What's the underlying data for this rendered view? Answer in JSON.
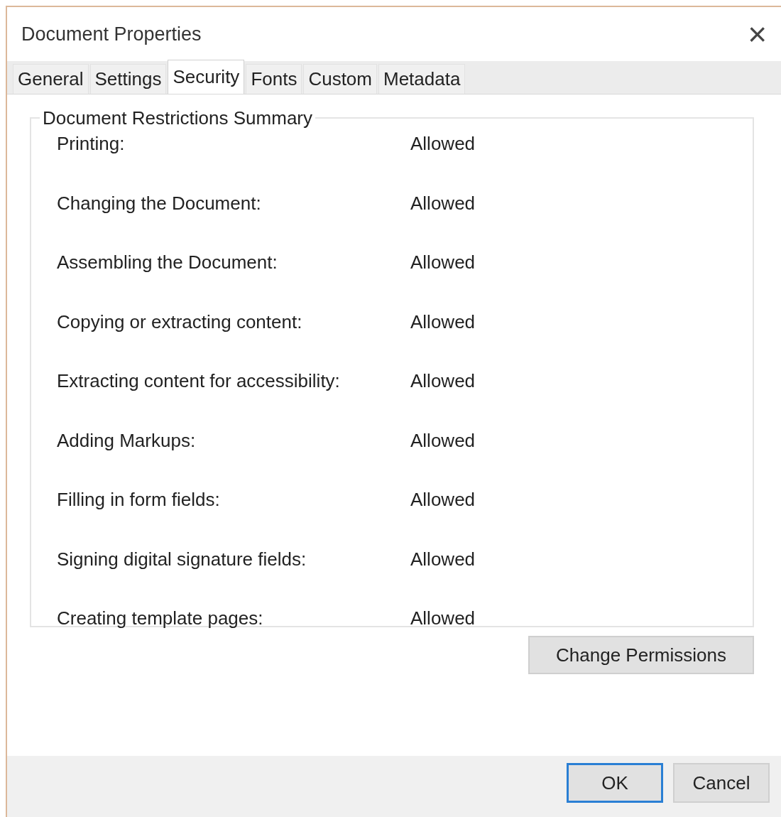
{
  "window": {
    "title": "Document Properties",
    "close": "×"
  },
  "tabs": [
    {
      "label": "General",
      "selected": false
    },
    {
      "label": "Settings",
      "selected": false
    },
    {
      "label": "Security",
      "selected": true
    },
    {
      "label": "Fonts",
      "selected": false
    },
    {
      "label": "Custom",
      "selected": false
    },
    {
      "label": "Metadata",
      "selected": false
    }
  ],
  "group": {
    "title": "Document Restrictions Summary",
    "rows": [
      {
        "label": "Printing:",
        "value": "Allowed"
      },
      {
        "label": "Changing the Document:",
        "value": "Allowed"
      },
      {
        "label": "Assembling the Document:",
        "value": "Allowed"
      },
      {
        "label": "Copying or extracting content:",
        "value": "Allowed"
      },
      {
        "label": "Extracting content for accessibility:",
        "value": "Allowed"
      },
      {
        "label": "Adding Markups:",
        "value": "Allowed"
      },
      {
        "label": "Filling in form fields:",
        "value": "Allowed"
      },
      {
        "label": "Signing digital signature fields:",
        "value": "Allowed"
      },
      {
        "label": "Creating template pages:",
        "value": "Allowed"
      }
    ]
  },
  "change_button": "Change Permissions",
  "buttons": [
    {
      "label": "OK",
      "default": true
    },
    {
      "label": "Cancel",
      "default": false
    }
  ]
}
